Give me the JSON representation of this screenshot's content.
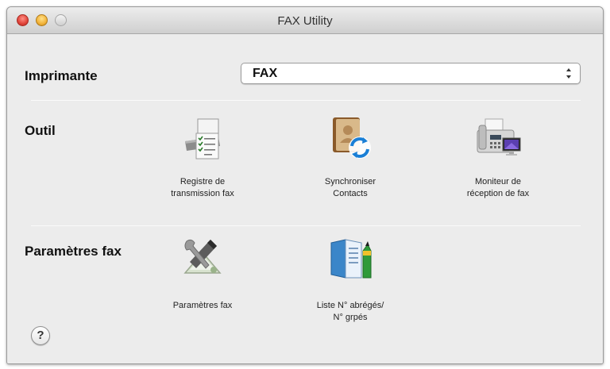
{
  "window": {
    "title": "FAX Utility"
  },
  "printer": {
    "label": "Imprimante",
    "selected": "FAX"
  },
  "tools": {
    "label": "Outil",
    "items": [
      {
        "label": "Registre de\ntransmission fax",
        "icon": "transmission-log-icon"
      },
      {
        "label": "Synchroniser\nContacts",
        "icon": "sync-contacts-icon"
      },
      {
        "label": "Moniteur de\nréception de fax",
        "icon": "fax-receive-monitor-icon"
      }
    ]
  },
  "fax_settings": {
    "label": "Paramètres fax",
    "items": [
      {
        "label": "Paramètres fax",
        "icon": "fax-settings-tools-icon"
      },
      {
        "label": "Liste N° abrégés/\nN° grpés",
        "icon": "speed-dial-list-icon"
      }
    ]
  },
  "help": {
    "label": "?"
  },
  "colors": {
    "close": "#e0443a",
    "minimize": "#f2b33a",
    "window_bg": "#ececec"
  }
}
